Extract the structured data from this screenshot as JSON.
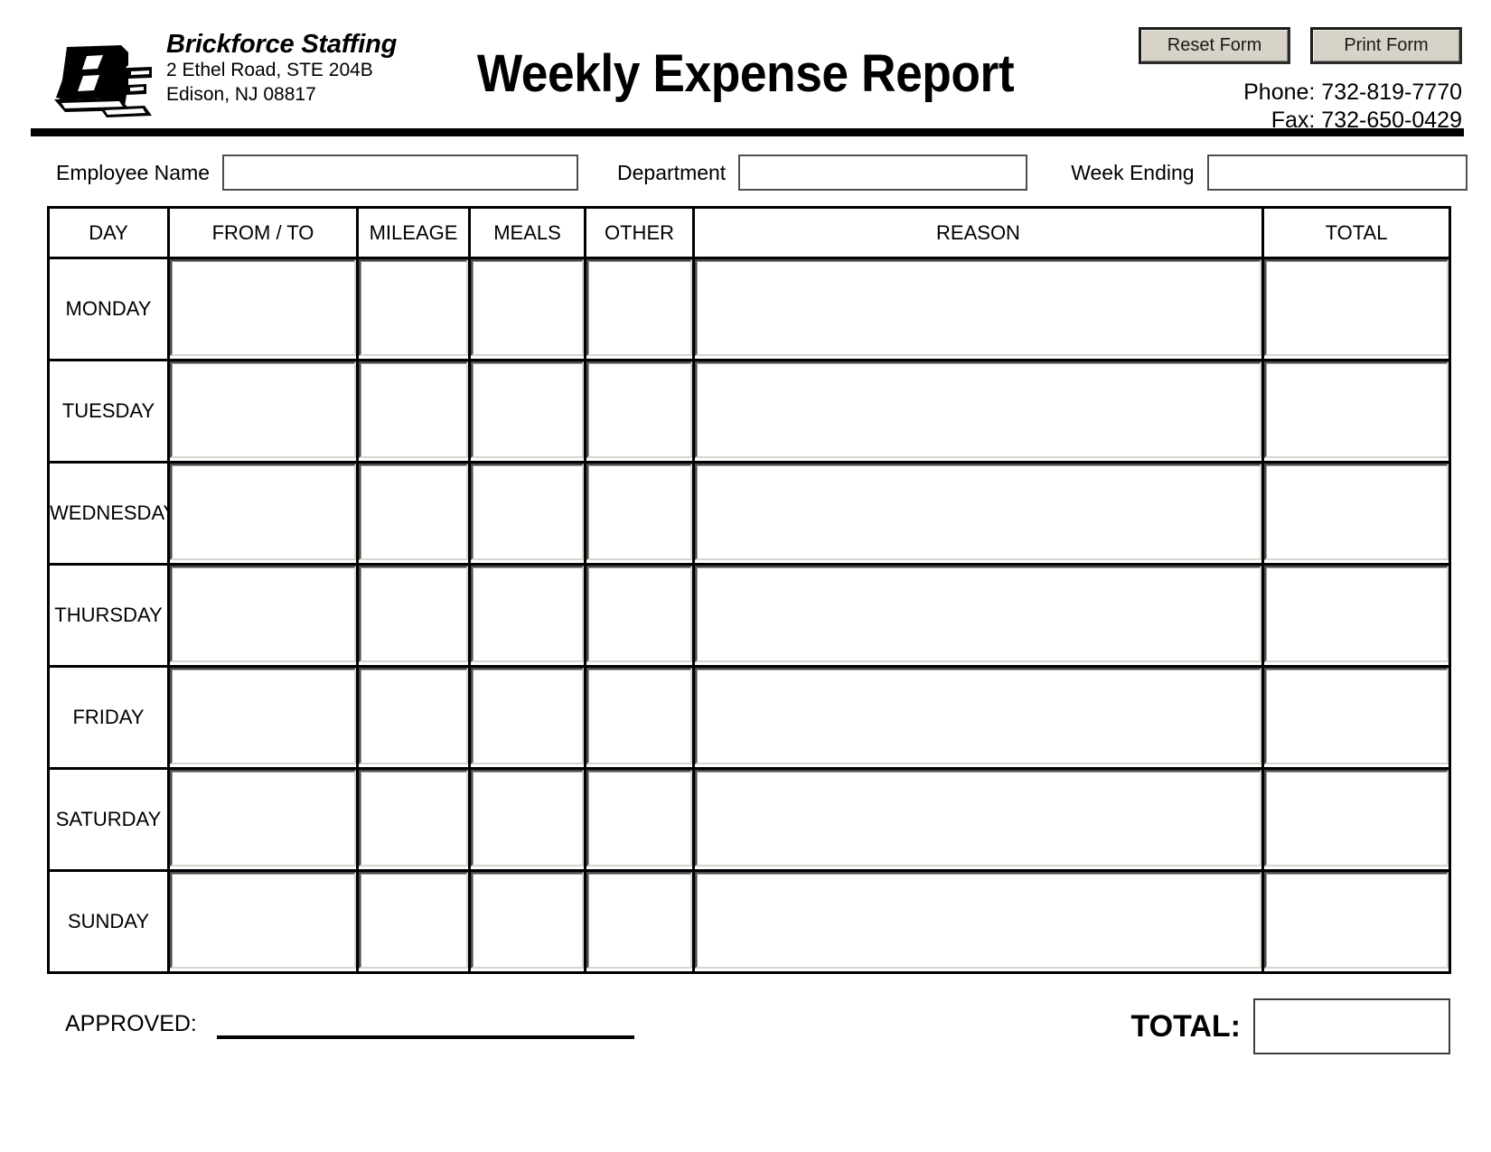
{
  "header": {
    "logo_icon": "brickforce-bf-monogram-logo",
    "company_name": "Brickforce Staffing",
    "address_line1": "2 Ethel Road, STE 204B",
    "address_line2": "Edison, NJ 08817",
    "title": "Weekly Expense Report",
    "reset_button": "Reset Form",
    "print_button": "Print Form",
    "phone": "Phone: 732-819-7770",
    "fax": "Fax: 732-650-0429"
  },
  "meta": {
    "employee_name_label": "Employee Name",
    "employee_name_value": "",
    "department_label": "Department",
    "department_value": "",
    "week_ending_label": "Week Ending",
    "week_ending_value": ""
  },
  "table": {
    "columns": [
      "DAY",
      "FROM / TO",
      "MILEAGE",
      "MEALS",
      "OTHER",
      "REASON",
      "TOTAL"
    ],
    "rows": [
      {
        "day": "MONDAY",
        "from_to": "",
        "mileage": "",
        "meals": "",
        "other": "",
        "reason": "",
        "total": ""
      },
      {
        "day": "TUESDAY",
        "from_to": "",
        "mileage": "",
        "meals": "",
        "other": "",
        "reason": "",
        "total": ""
      },
      {
        "day": "WEDNESDAY",
        "from_to": "",
        "mileage": "",
        "meals": "",
        "other": "",
        "reason": "",
        "total": ""
      },
      {
        "day": "THURSDAY",
        "from_to": "",
        "mileage": "",
        "meals": "",
        "other": "",
        "reason": "",
        "total": ""
      },
      {
        "day": "FRIDAY",
        "from_to": "",
        "mileage": "",
        "meals": "",
        "other": "",
        "reason": "",
        "total": ""
      },
      {
        "day": "SATURDAY",
        "from_to": "",
        "mileage": "",
        "meals": "",
        "other": "",
        "reason": "",
        "total": ""
      },
      {
        "day": "SUNDAY",
        "from_to": "",
        "mileage": "",
        "meals": "",
        "other": "",
        "reason": "",
        "total": ""
      }
    ]
  },
  "footer": {
    "approved_label": "APPROVED:",
    "approved_value": "",
    "total_label": "TOTAL:",
    "total_value": ""
  },
  "colors": {
    "page_background": "#ffffff",
    "ink": "#000000",
    "button_face": "#d7d3c8",
    "field_border": "#4e4e4e"
  }
}
